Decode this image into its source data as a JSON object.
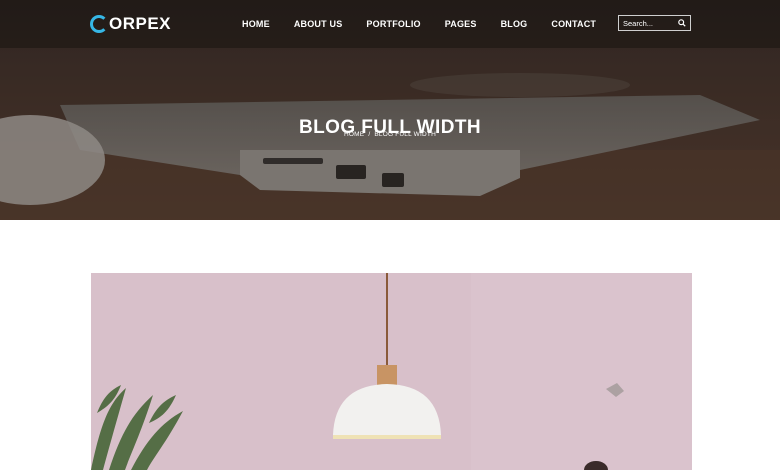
{
  "brand": {
    "logo_text": "ORPEX",
    "accent_color": "#36b7e6"
  },
  "nav": {
    "items": [
      {
        "label": "HOME"
      },
      {
        "label": "ABOUT US"
      },
      {
        "label": "PORTFOLIO"
      },
      {
        "label": "PAGES"
      },
      {
        "label": "BLOG"
      },
      {
        "label": "CONTACT"
      }
    ]
  },
  "search": {
    "placeholder": "Search...",
    "icon": "search-icon"
  },
  "hero": {
    "title": "BLOG FULL WIDTH",
    "breadcrumb": {
      "home": "HOME",
      "separator": "/",
      "current": "BLOG FULL WIDTH"
    }
  },
  "post": {
    "image": "pendant-lamp-photo"
  }
}
